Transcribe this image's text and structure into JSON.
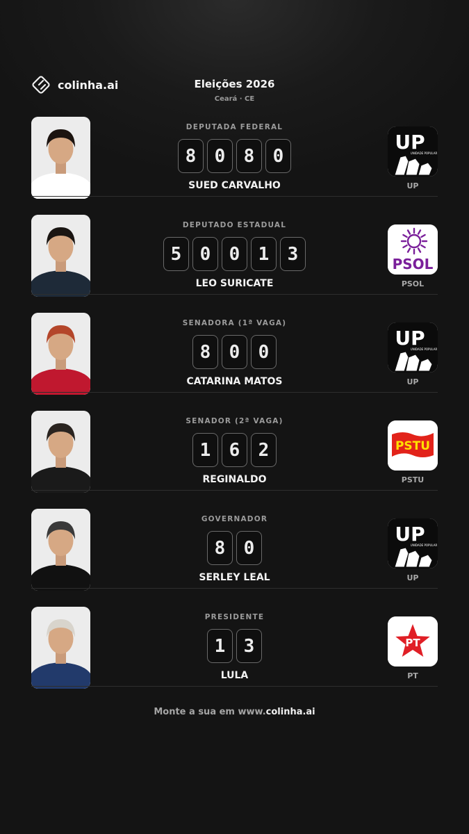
{
  "header": {
    "brand": "colinha.ai",
    "title": "Eleições 2026",
    "subtitle": "Ceará · CE"
  },
  "candidates": [
    {
      "role": "DEPUTADA FEDERAL",
      "number": "8080",
      "name": "SUED CARVALHO",
      "party": "UP",
      "shirt_color": "#ffffff",
      "hair_color": "#1c1410"
    },
    {
      "role": "DEPUTADO ESTADUAL",
      "number": "50013",
      "name": "LEO SURICATE",
      "party": "PSOL",
      "shirt_color": "#1e2a38",
      "hair_color": "#1a1512"
    },
    {
      "role": "SENADORA (1ª VAGA)",
      "number": "800",
      "name": "CATARINA MATOS",
      "party": "UP",
      "shirt_color": "#c0182f",
      "hair_color": "#b4462a"
    },
    {
      "role": "SENADOR (2ª VAGA)",
      "number": "162",
      "name": "REGINALDO",
      "party": "PSTU",
      "shirt_color": "#1a1a1a",
      "hair_color": "#2a2420"
    },
    {
      "role": "GOVERNADOR",
      "number": "80",
      "name": "SERLEY LEAL",
      "party": "UP",
      "shirt_color": "#111111",
      "hair_color": "#3a3a3a"
    },
    {
      "role": "PRESIDENTE",
      "number": "13",
      "name": "LULA",
      "party": "PT",
      "shirt_color": "#223a6b",
      "hair_color": "#d8d4cc"
    }
  ],
  "footer": {
    "prefix": "Monte a sua em www.",
    "brand": "colinha.ai"
  }
}
